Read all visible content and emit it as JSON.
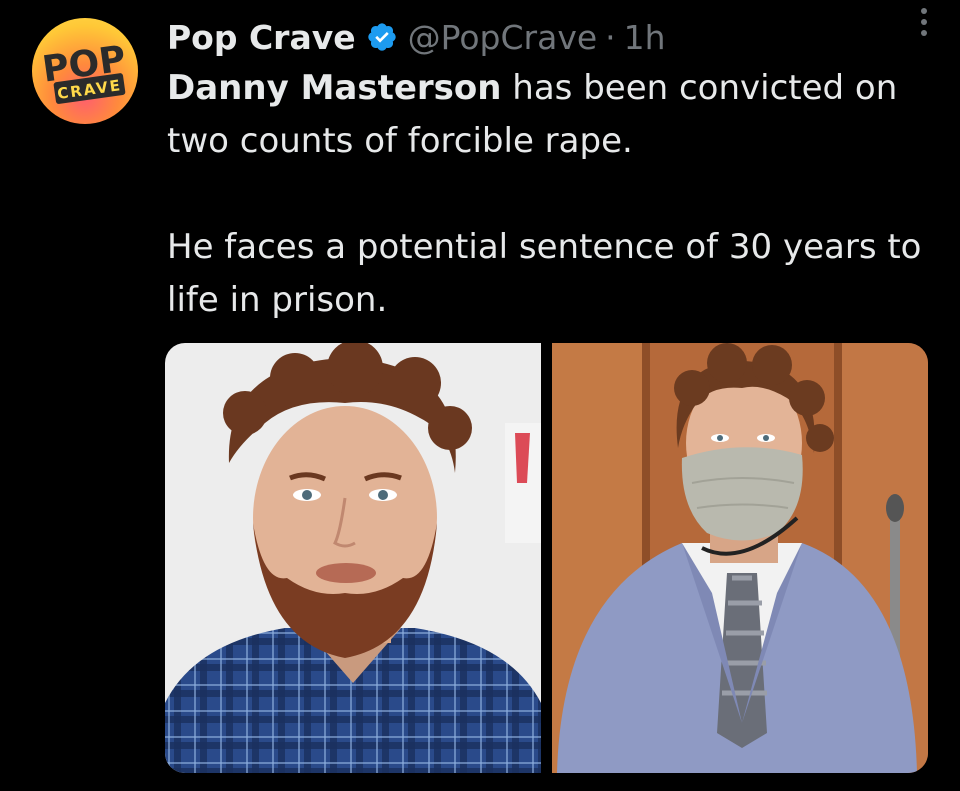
{
  "tweet": {
    "author": {
      "display_name": "Pop Crave",
      "handle": "@PopCrave",
      "verified": true,
      "avatar_logo_top": "POP",
      "avatar_logo_bottom": "CRAVE"
    },
    "separator": "·",
    "timestamp": "1h",
    "body": {
      "line1_bold": "Danny Masterson",
      "line1_rest": " has been convicted on two counts of forcible rape.",
      "line2": "He faces a potential sentence of 30 years to life in prison."
    },
    "media": [
      {
        "description_icon": "photo-portrait-beard"
      },
      {
        "description_icon": "photo-courtroom-mask"
      }
    ]
  },
  "colors": {
    "background": "#000000",
    "text_primary": "#e7e9ea",
    "text_secondary": "#71767b",
    "verified_blue": "#1d9bf0"
  }
}
